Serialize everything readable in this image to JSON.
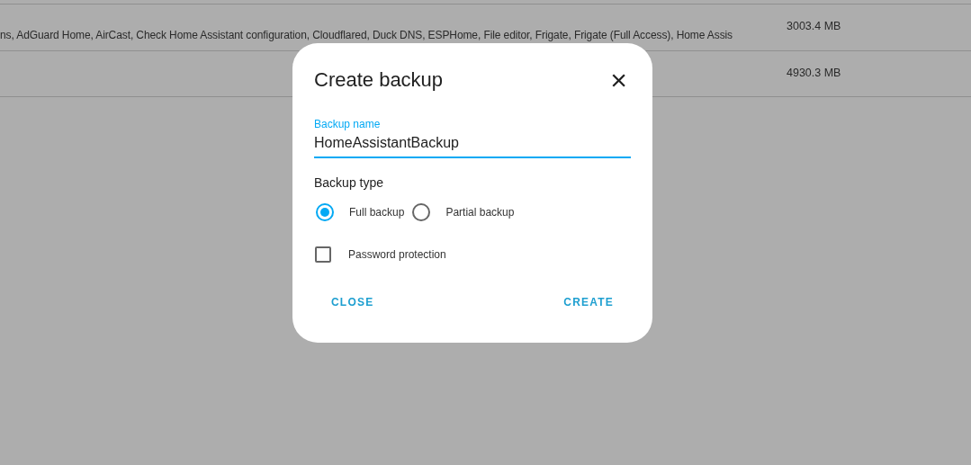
{
  "table": {
    "rows": [
      {
        "contents": "ns, AdGuard Home, AirCast, Check Home Assistant configuration, Cloudflared, Duck DNS, ESPHome, File editor, Frigate, Frigate (Full Access), Home Assis",
        "size": "3003.4 MB"
      },
      {
        "contents": "",
        "size": "4930.3 MB"
      }
    ]
  },
  "dialog": {
    "title": "Create backup",
    "close_icon": "×",
    "name_field": {
      "label": "Backup name",
      "value": "HomeAssistantBackup"
    },
    "type_label": "Backup type",
    "options": [
      {
        "label": "Full backup",
        "selected": true
      },
      {
        "label": "Partial backup",
        "selected": false
      }
    ],
    "password_protection": {
      "label": "Password protection",
      "checked": false
    },
    "buttons": [
      "CLOSE",
      "CREATE"
    ]
  }
}
